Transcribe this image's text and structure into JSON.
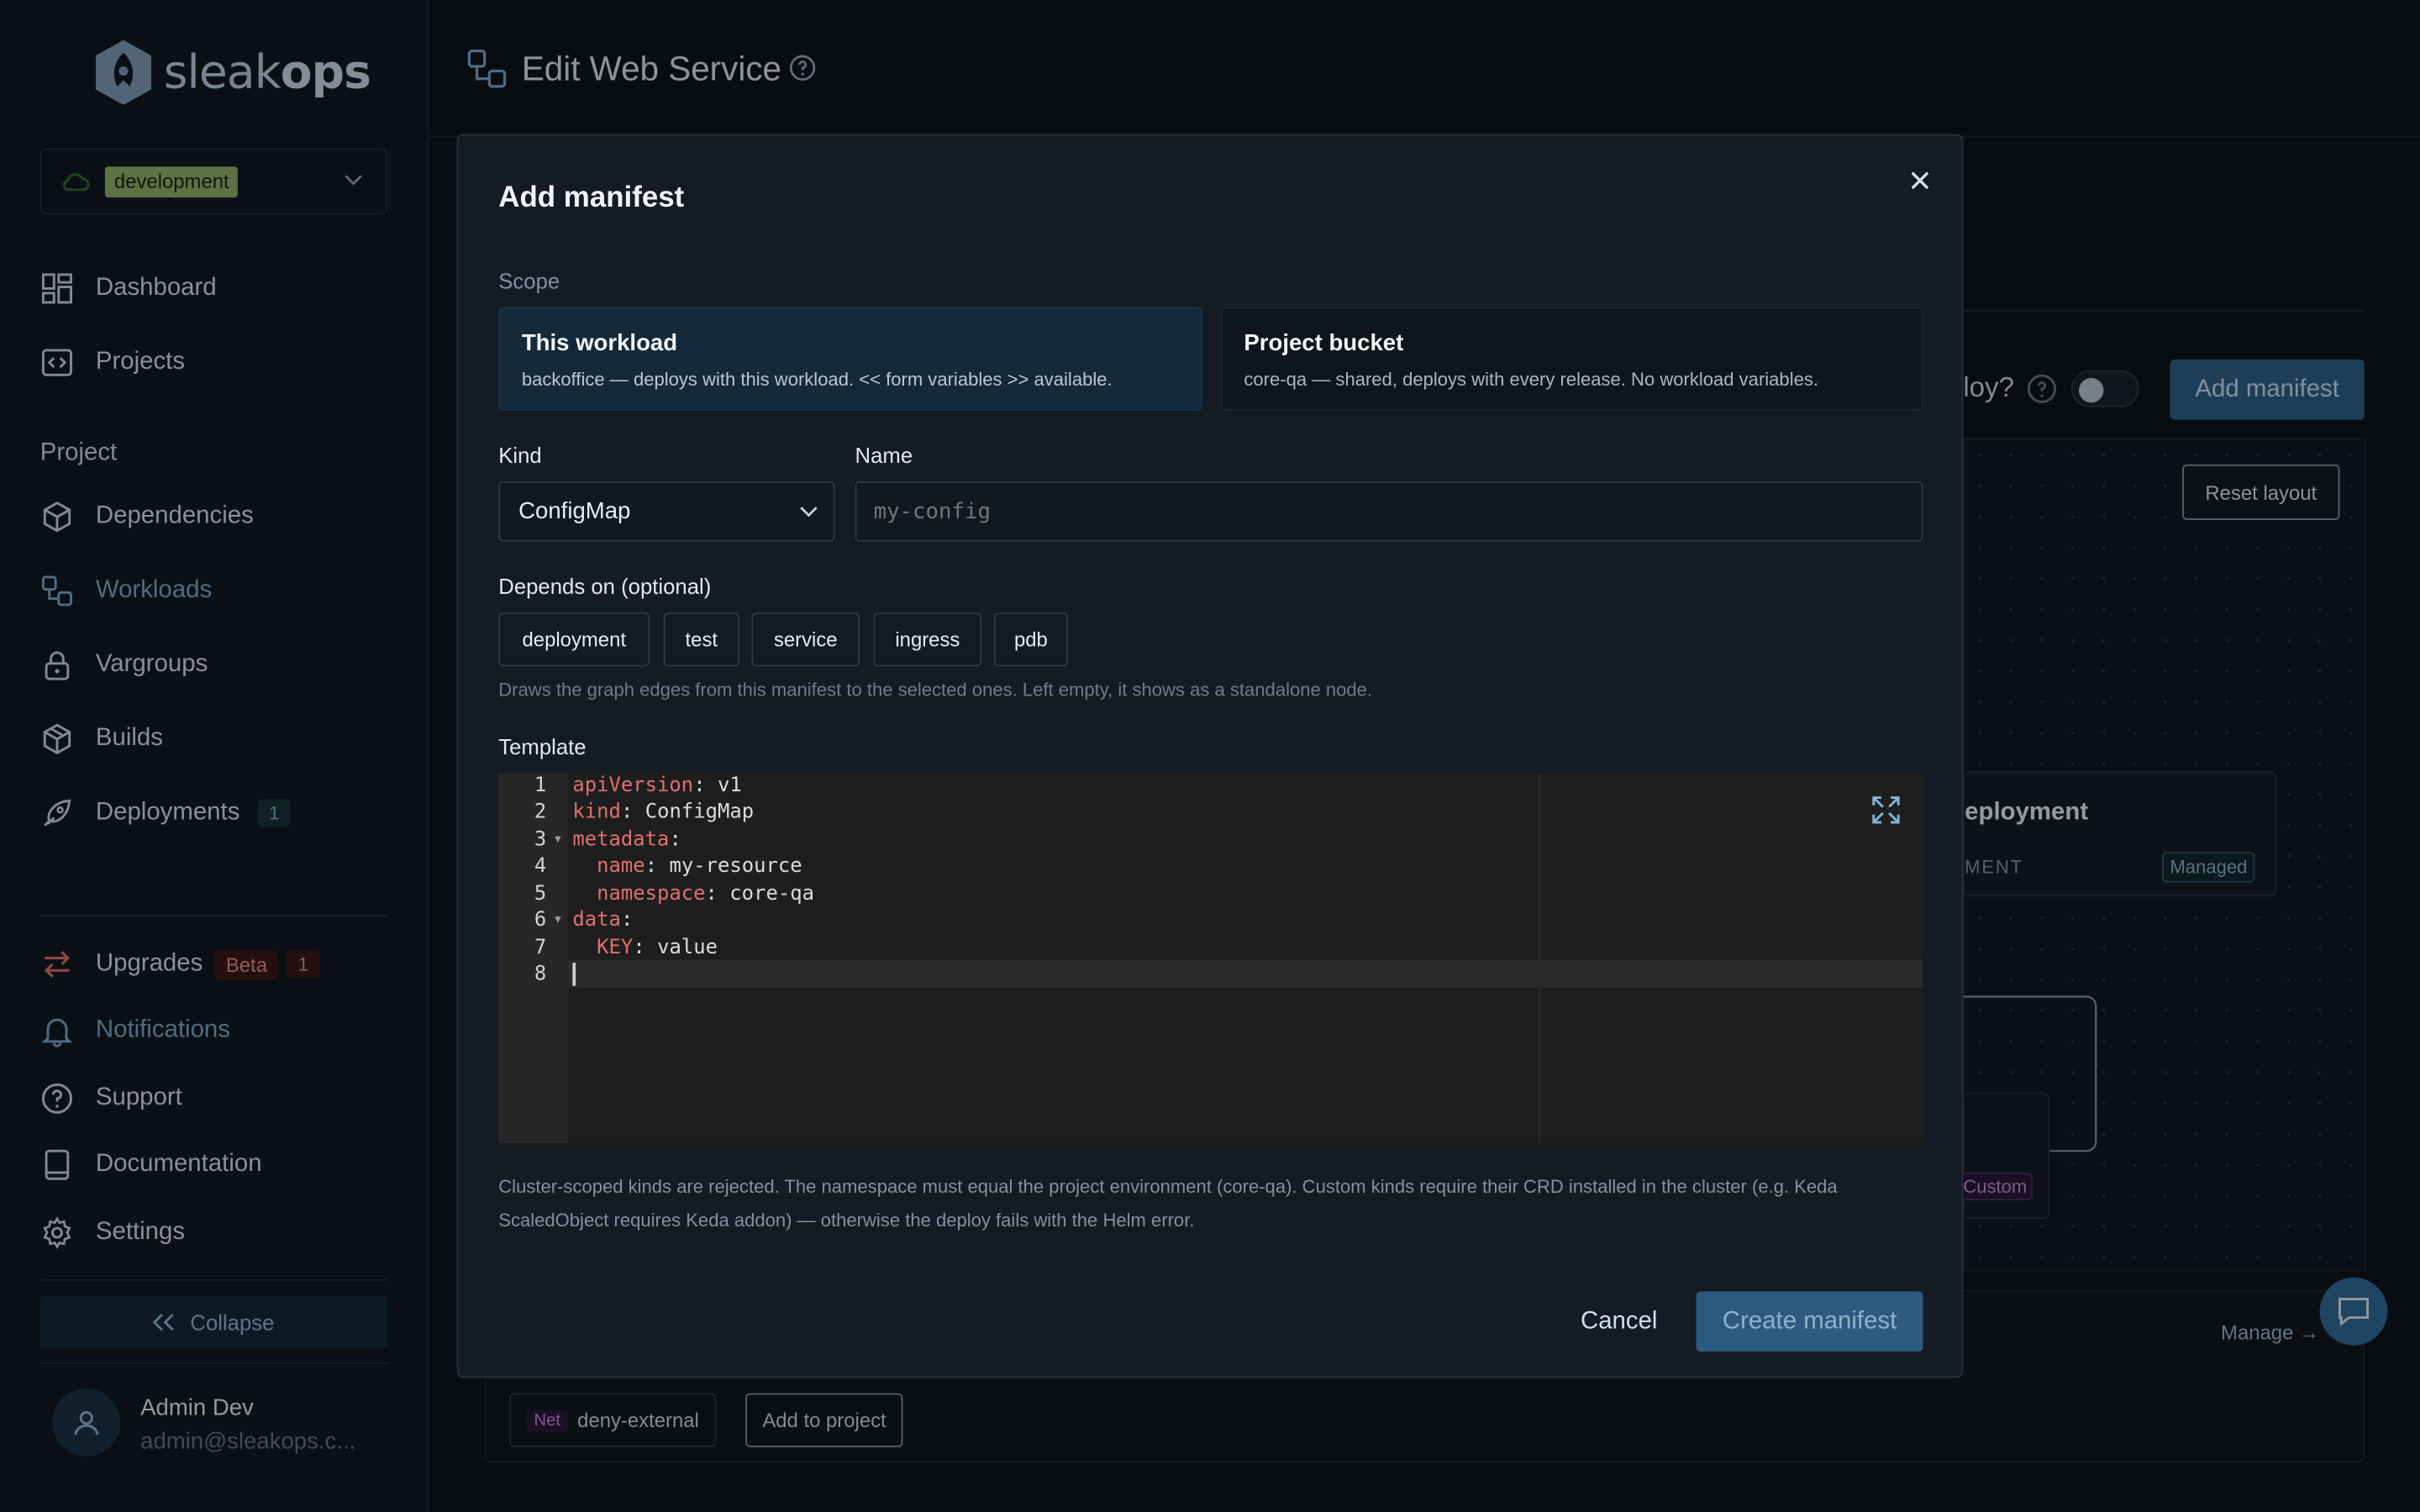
{
  "brand": {
    "name_light": "sleak",
    "name_bold": "ops"
  },
  "environment": {
    "selected": "development"
  },
  "sidebar": {
    "main_items": [
      {
        "label": "Dashboard"
      },
      {
        "label": "Projects"
      }
    ],
    "project_section": "Project",
    "project_items": [
      {
        "label": "Dependencies"
      },
      {
        "label": "Workloads"
      },
      {
        "label": "Vargroups"
      },
      {
        "label": "Builds"
      },
      {
        "label": "Deployments",
        "badge": "1"
      }
    ],
    "bottom_items": [
      {
        "label": "Upgrades",
        "badge": "Beta",
        "count": "1"
      },
      {
        "label": "Notifications"
      },
      {
        "label": "Support"
      },
      {
        "label": "Documentation"
      },
      {
        "label": "Settings"
      }
    ],
    "collapse_label": "Collapse",
    "user": {
      "name": "Admin Dev",
      "email": "admin@sleakops.c..."
    }
  },
  "header": {
    "title": "Edit Web Service"
  },
  "background": {
    "deploy_question": "loy?",
    "add_manifest": "Add manifest",
    "reset_layout": "Reset layout",
    "node_title": "eployment",
    "node_sub": "MENT",
    "node_badge": "Managed",
    "custom_badge": "Custom",
    "manage_link": "Manage →",
    "policy_badge": "Net",
    "policy_name": "deny-external",
    "add_to_project": "Add to project"
  },
  "modal": {
    "title": "Add manifest",
    "scope_label": "Scope",
    "scope_options": [
      {
        "title": "This workload",
        "desc": "backoffice — deploys with this workload. << form variables >> available.",
        "selected": true
      },
      {
        "title": "Project bucket",
        "desc": "core-qa — shared, deploys with every release. No workload variables.",
        "selected": false
      }
    ],
    "kind_label": "Kind",
    "kind_value": "ConfigMap",
    "name_label": "Name",
    "name_placeholder": "my-config",
    "depends_label": "Depends on (optional)",
    "depends_options": [
      "deployment",
      "test",
      "service",
      "ingress",
      "pdb"
    ],
    "depends_help": "Draws the graph edges from this manifest to the selected ones. Left empty, it shows as a standalone node.",
    "template_label": "Template",
    "template_lines": [
      {
        "n": "1",
        "key": "apiVersion",
        "val": " v1"
      },
      {
        "n": "2",
        "key": "kind",
        "val": " ConfigMap"
      },
      {
        "n": "3",
        "key": "metadata",
        "val": ""
      },
      {
        "n": "4",
        "key": "  name",
        "val": " my-resource"
      },
      {
        "n": "5",
        "key": "  namespace",
        "val": " core-qa"
      },
      {
        "n": "6",
        "key": "data",
        "val": ""
      },
      {
        "n": "7",
        "key": "  KEY",
        "val": " value"
      },
      {
        "n": "8",
        "key": "",
        "val": ""
      }
    ],
    "note": "Cluster-scoped kinds are rejected. The namespace must equal the project environment (core-qa). Custom kinds require their CRD installed in the cluster (e.g. Keda ScaledObject requires Keda addon) — otherwise the deploy fails with the Helm error.",
    "cancel": "Cancel",
    "create": "Create manifest"
  },
  "colors": {
    "accent": "#2f5e86",
    "active_nav": "#7aa6c9",
    "env_badge": "#8fb069"
  }
}
